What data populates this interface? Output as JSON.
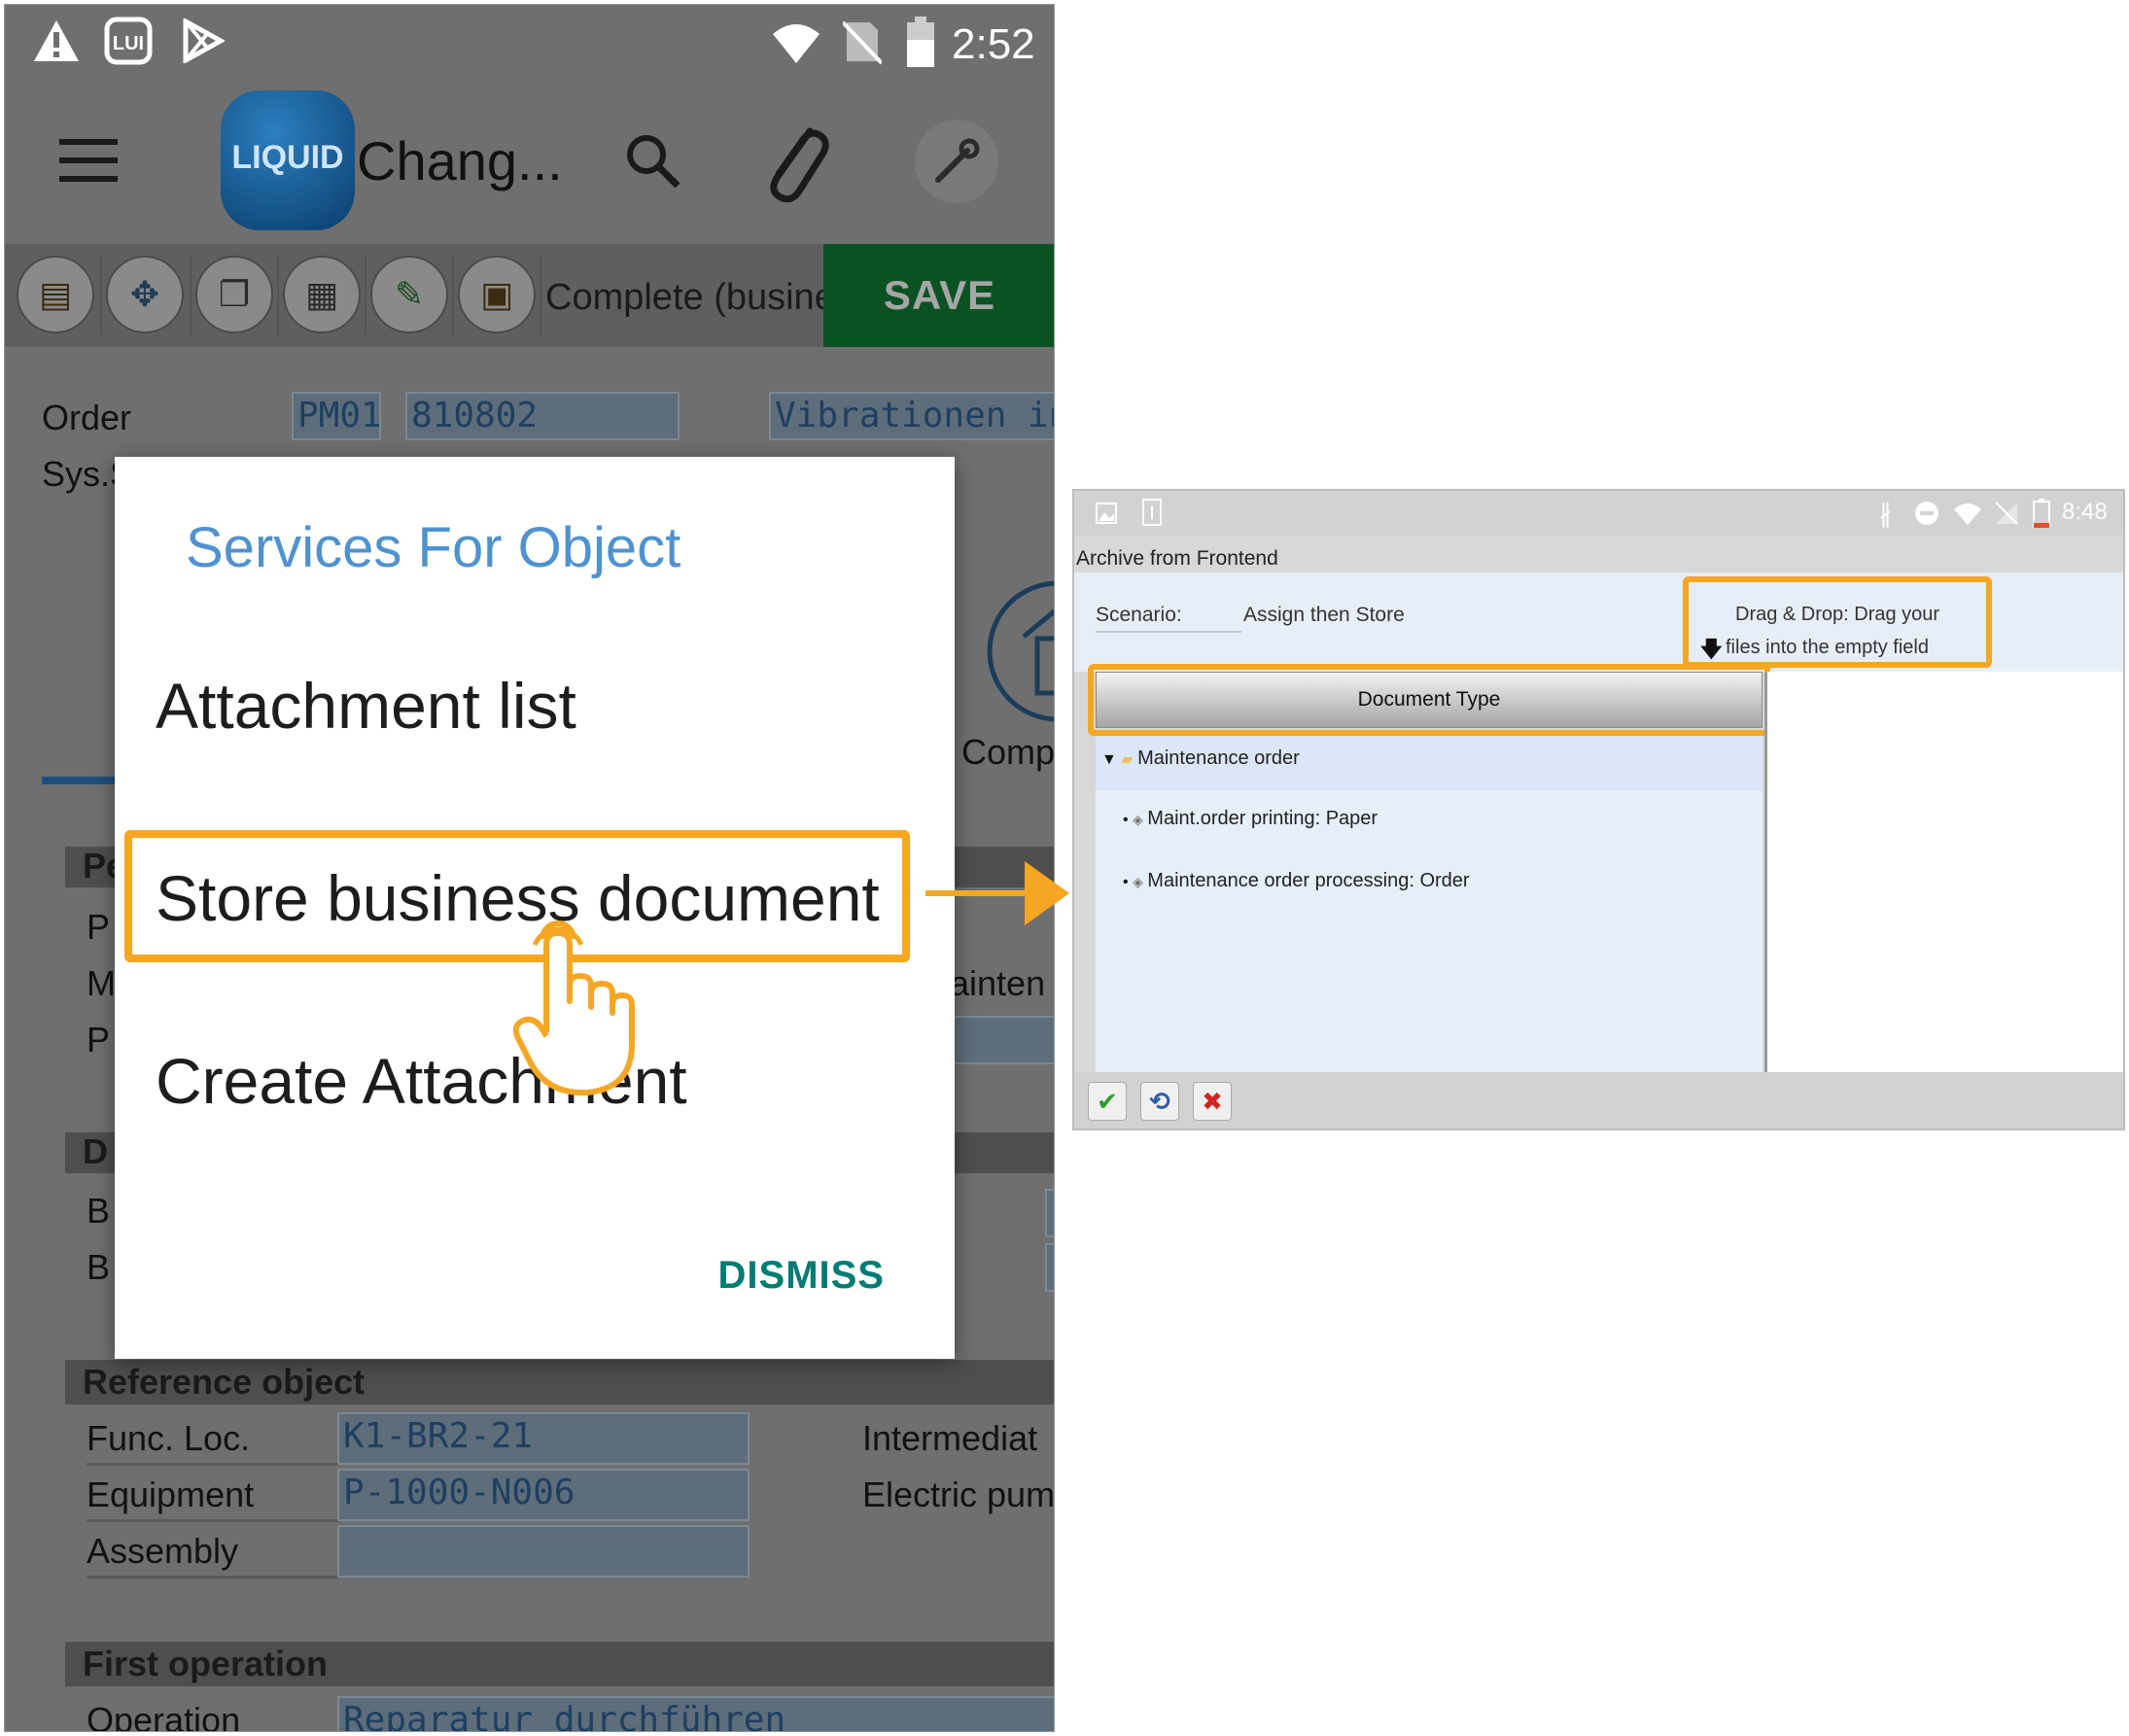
{
  "phone": {
    "status_bar": {
      "time": "2:52"
    },
    "app_bar": {
      "logo_text": "LIQUID",
      "title": "Chang..."
    },
    "toolbar": {
      "status_text": "Complete (busine",
      "save_label": "SAVE"
    },
    "background": {
      "order_label": "Order",
      "order_type": "PM01",
      "order_number": "810802",
      "order_desc": "Vibrationen in",
      "sys_label": "Sys.S",
      "comp_label": "Comp",
      "mainten_text": "ainten",
      "section_p": "Pe",
      "row_p1": "P",
      "row_m": "M",
      "row_p2": "P",
      "section_d": "D",
      "row_b1": "B",
      "row_b2": "B",
      "ref_section": "Reference object",
      "func_loc_label": "Func. Loc.",
      "func_loc_value": "K1-BR2-21",
      "func_loc_desc": "Intermediat",
      "equipment_label": "Equipment",
      "equipment_value": "P-1000-N006",
      "equipment_desc": "Electric pum",
      "assembly_label": "Assembly",
      "first_op_section": "First operation",
      "operation_label": "Operation",
      "operation_value": "Reparatur durchführen"
    },
    "dialog": {
      "title": "Services For Object",
      "items": [
        "Attachment list",
        "Store business document",
        "Create Attachment"
      ],
      "dismiss": "DISMISS"
    },
    "colors": {
      "highlight": "#f5a623",
      "dialog_title": "#4f92cf",
      "dismiss": "#007c72",
      "save_bg": "#0b5223"
    }
  },
  "tablet": {
    "status_bar": {
      "time": "8:48"
    },
    "window_title": "Archive from Frontend",
    "scenario_label": "Scenario:",
    "scenario_value": "Assign then Store",
    "drag_drop_line1": "Drag & Drop: Drag your",
    "drag_drop_line2": "files into the empty field",
    "column_header": "Document Type",
    "tree": {
      "root": "Maintenance order",
      "children": [
        "Maint.order printing: Paper",
        "Maintenance order processing: Order"
      ]
    },
    "footer_buttons": [
      "confirm-icon",
      "undo-icon",
      "cancel-icon"
    ]
  }
}
